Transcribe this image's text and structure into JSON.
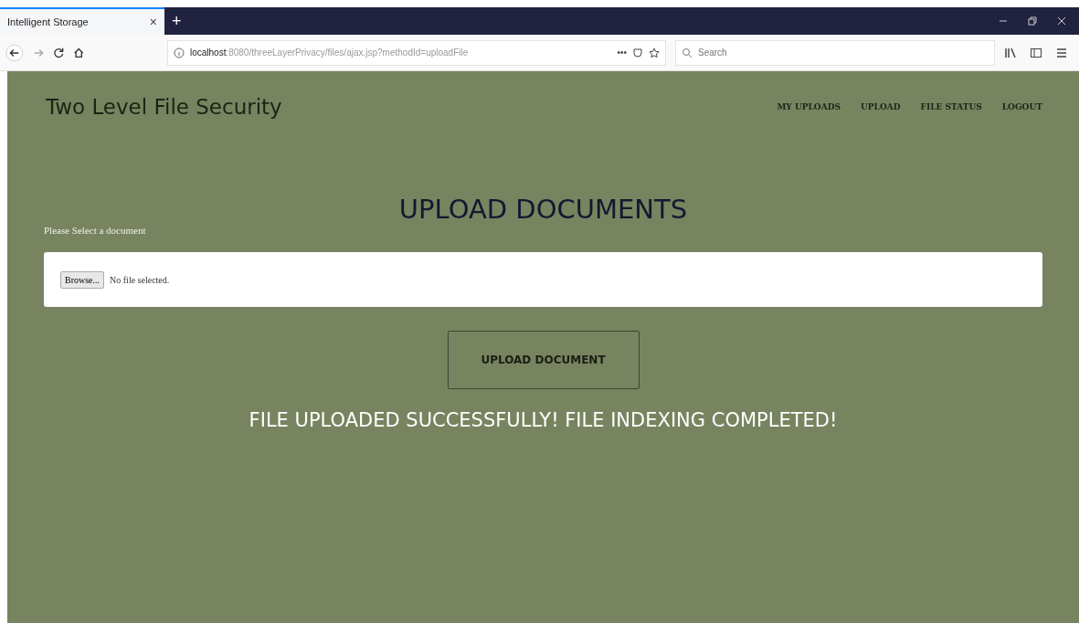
{
  "browser": {
    "tab_title": "Intelligent Storage",
    "tab_close": "×",
    "new_tab": "+",
    "url_host": "localhost",
    "url_rest": ":8080/threeLayerPrivacy/files/ajax.jsp?methodId=uploadFile",
    "page_actions": "•••",
    "search": {
      "placeholder": "Search"
    }
  },
  "site": {
    "brand": "Two Level File Security",
    "nav": [
      {
        "label": "MY UPLOADS"
      },
      {
        "label": "UPLOAD"
      },
      {
        "label": "FILE STATUS"
      },
      {
        "label": "LOGOUT"
      }
    ],
    "heading": "UPLOAD DOCUMENTS",
    "field_label": "Please Select a document",
    "browse_button": "Browse...",
    "file_status": "No file selected.",
    "submit_button": "UPLOAD DOCUMENT",
    "message": "FILE UPLOADED SUCCESSFULLY! FILE INDEXING COMPLETED!"
  }
}
